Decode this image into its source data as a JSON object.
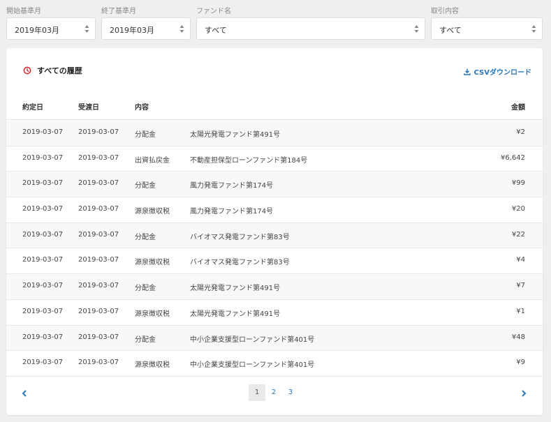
{
  "filters": {
    "start_month": {
      "label": "開始基準月",
      "value": "2019年03月"
    },
    "end_month": {
      "label": "終了基準月",
      "value": "2019年03月"
    },
    "fund_name": {
      "label": "ファンド名",
      "value": "すべて"
    },
    "transaction_type": {
      "label": "取引内容",
      "value": "すべて"
    }
  },
  "card": {
    "title": "すべての履歴",
    "csv_label": "CSVダウンロード"
  },
  "table": {
    "headers": {
      "contract_date": "約定日",
      "delivery_date": "受渡日",
      "type": "内容",
      "fund": "",
      "amount": "金額"
    },
    "rows": [
      {
        "contract_date": "2019-03-07",
        "delivery_date": "2019-03-07",
        "type": "分配金",
        "fund": "太陽光発電ファンド第491号",
        "amount": "¥2"
      },
      {
        "contract_date": "2019-03-07",
        "delivery_date": "2019-03-07",
        "type": "出資払戻金",
        "fund": "不動産担保型ローンファンド第184号",
        "amount": "¥6,642"
      },
      {
        "contract_date": "2019-03-07",
        "delivery_date": "2019-03-07",
        "type": "分配金",
        "fund": "風力発電ファンド第174号",
        "amount": "¥99"
      },
      {
        "contract_date": "2019-03-07",
        "delivery_date": "2019-03-07",
        "type": "源泉徴収税",
        "fund": "風力発電ファンド第174号",
        "amount": "¥20"
      },
      {
        "contract_date": "2019-03-07",
        "delivery_date": "2019-03-07",
        "type": "分配金",
        "fund": "バイオマス発電ファンド第83号",
        "amount": "¥22"
      },
      {
        "contract_date": "2019-03-07",
        "delivery_date": "2019-03-07",
        "type": "源泉徴収税",
        "fund": "バイオマス発電ファンド第83号",
        "amount": "¥4"
      },
      {
        "contract_date": "2019-03-07",
        "delivery_date": "2019-03-07",
        "type": "分配金",
        "fund": "太陽光発電ファンド第491号",
        "amount": "¥7"
      },
      {
        "contract_date": "2019-03-07",
        "delivery_date": "2019-03-07",
        "type": "源泉徴収税",
        "fund": "太陽光発電ファンド第491号",
        "amount": "¥1"
      },
      {
        "contract_date": "2019-03-07",
        "delivery_date": "2019-03-07",
        "type": "分配金",
        "fund": "中小企業支援型ローンファンド第401号",
        "amount": "¥48"
      },
      {
        "contract_date": "2019-03-07",
        "delivery_date": "2019-03-07",
        "type": "源泉徴収税",
        "fund": "中小企業支援型ローンファンド第401号",
        "amount": "¥9"
      }
    ]
  },
  "pagination": {
    "pages": [
      "1",
      "2",
      "3"
    ],
    "current": "1"
  },
  "icons": {
    "history": "clock-icon",
    "download": "download-icon",
    "select_arrows": "sort-arrows-icon",
    "prev": "chevron-left-icon",
    "next": "chevron-right-icon"
  },
  "colors": {
    "accent": "#2a77b8",
    "history_icon": "#d9262e"
  }
}
